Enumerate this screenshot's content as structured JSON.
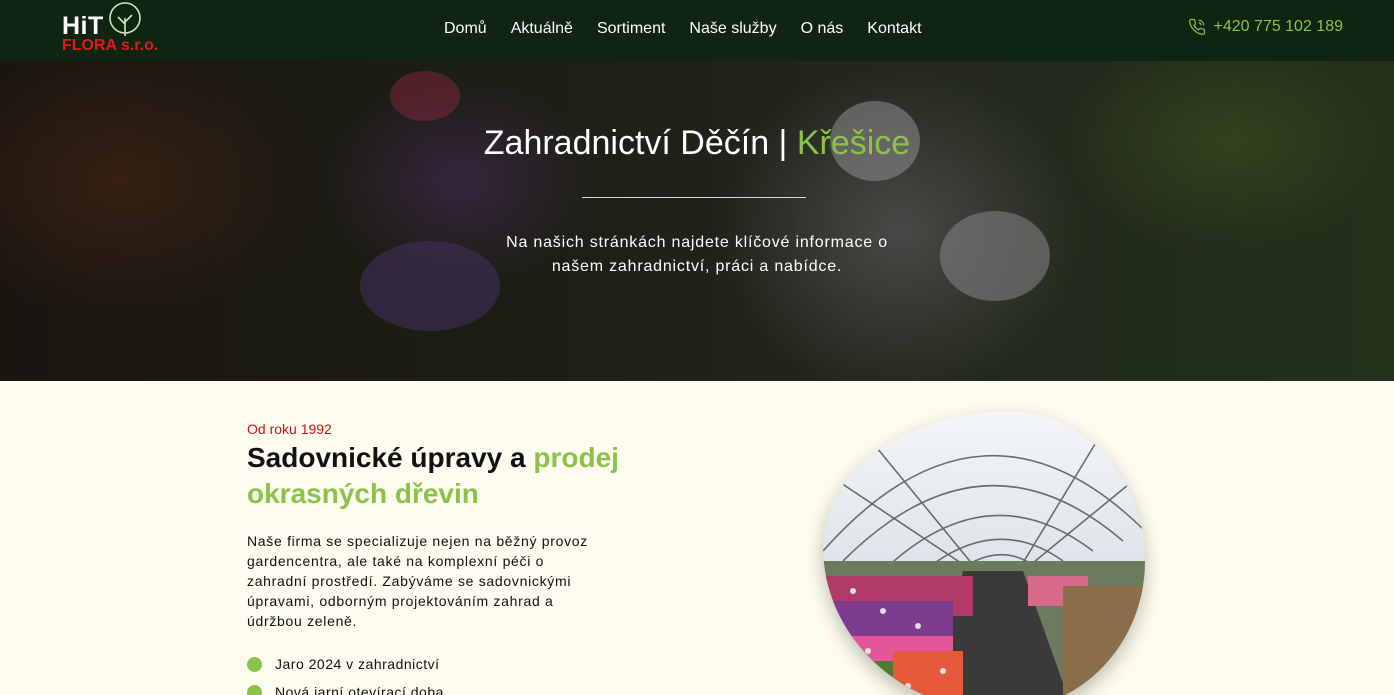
{
  "header": {
    "logo": {
      "line1": "HiT",
      "line2": "FLORA s.r.o."
    },
    "nav": [
      "Domů",
      "Aktuálně",
      "Sortiment",
      "Naše služby",
      "O nás",
      "Kontakt"
    ],
    "phone": "+420 775 102 189",
    "phone_icon": "phone-icon"
  },
  "hero": {
    "title_main": "Zahradnictví Děčín | ",
    "title_accent": "Křešice",
    "subtitle": "Na našich stránkách najdete klíčové informace o našem zahradnictví, práci a nabídce."
  },
  "about": {
    "kicker": "Od roku 1992",
    "heading_main": "Sadovnické úpravy a ",
    "heading_accent": "prodej okrasných dřevin",
    "description": "Naše firma se specializuje nejen na běžný provoz gardencentra, ale také na komplexní péči o zahradní prostředí. Zabýváme se sadovnickými úpravami, odborným projektováním zahrad a údržbou zeleně.",
    "features": [
      "Jaro 2024 v zahradnictví",
      "Nová jarní otevírací doba"
    ]
  },
  "colors": {
    "accent": "#8bc34a",
    "header_bg": "#0f2411",
    "kicker": "#c0161c",
    "page_bg": "#fdfcee"
  }
}
